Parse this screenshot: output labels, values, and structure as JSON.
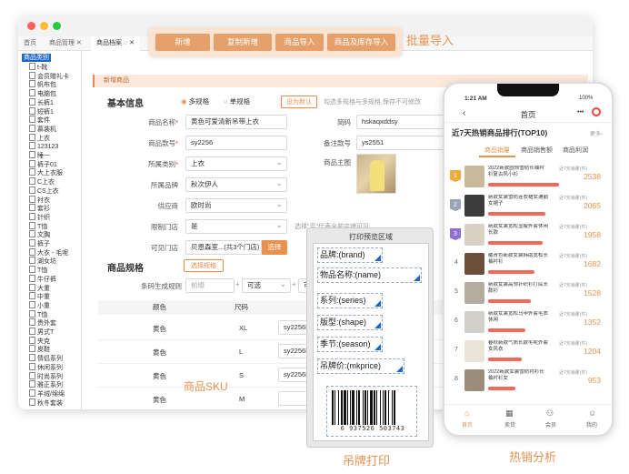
{
  "window": {
    "tabs": [
      "首页",
      "商品管理",
      "商品档案"
    ],
    "sidebar_root": "商品类别",
    "sidebar_items": [
      "t-靴",
      "会员赠礼卡",
      "帆布包",
      "电脑包",
      "长裤1",
      "短裤1",
      "套件",
      "慕装机",
      "上衣",
      "123123",
      "睡一",
      "裤子01",
      "大上衣服",
      "C上衣",
      "CS上衣",
      "衬衣",
      "套衫",
      "针织",
      "T恤",
      "文胸",
      "裤子",
      "大衣 - 毛呢",
      "湖女坊",
      "T恤",
      "牛仔裤",
      "大重",
      "中重",
      "小重",
      "T恤",
      "贵外套",
      "男式T",
      "夹克",
      "皮鞋",
      "情侣系列",
      "休闲系列",
      "时尚系列",
      "雅正系列",
      "羊绒/绵绵",
      "秋冬套装"
    ],
    "section_title": "新增商品",
    "basic_info_heading": "基本信息",
    "spec_mode": {
      "multi": "多规格",
      "single": "单规格",
      "switch_button": "设为默认",
      "hint": "勾选多规格与多规格,保存不可修改"
    },
    "fields": {
      "name": {
        "label": "商品名称",
        "value": "黄色可爱清新吊带上衣"
      },
      "code": {
        "label": "商品款号",
        "value": "sy2256"
      },
      "category": {
        "label": "所属类别",
        "value": "上衣"
      },
      "brand": {
        "label": "所属品牌",
        "value": "秋次伊人"
      },
      "supplier": {
        "label": "供应商",
        "value": "欧时尚"
      },
      "limit_store": {
        "label": "限制门店",
        "value": "是"
      },
      "visible_store": {
        "label": "可见门店",
        "value": "贝恩森室...(共3个门店)",
        "button": "选择"
      },
      "short_code": {
        "label": "简码",
        "value": "hskaqxddsy"
      },
      "note_code": {
        "label": "备注款号",
        "value": "ys2551"
      },
      "main_image": {
        "label": "商品主图"
      }
    },
    "limit_hint": "选择\"否\"代表全部店铺可见",
    "spec_heading": "商品规格",
    "spec_select_button": "选择规格",
    "barcode_rule_label": "条码生成规则",
    "barcode_rule_inputs": [
      "前缀",
      "可选",
      "可选"
    ],
    "table_headers": [
      "颜色",
      "尺码"
    ],
    "table_rows": [
      {
        "color": "黄色",
        "size": "XL",
        "code": "sy2256HS21"
      },
      {
        "color": "黄色",
        "size": "L",
        "code": "sy2256HS21"
      },
      {
        "color": "黄色",
        "size": "S",
        "code": "sy2256HS1"
      },
      {
        "color": "黄色",
        "size": "M",
        "code": ""
      }
    ]
  },
  "toolbar": {
    "buttons": [
      "新增",
      "复制新增",
      "商品导入",
      "商品及库存导入"
    ],
    "caption": "批量导入"
  },
  "print": {
    "title": "打印预览区域",
    "fields": [
      "品牌:(brand)",
      "物品名称:(name)",
      "系列:(series)",
      "版型:(shape)",
      "季节:(season)",
      "吊牌价:(mkprice)"
    ],
    "barcode_number": "6 937526 503743",
    "caption": "吊牌打印"
  },
  "sku_caption": "商品SKU",
  "phone": {
    "time": "1:21 AM",
    "battery": "100%",
    "nav_title": "首页",
    "page_title": "近7天热销商品排行(TOP10)",
    "more": "更多",
    "tabs": [
      "商品销量",
      "商品销售额",
      "商品利润"
    ],
    "unit": "近7天销量(件)",
    "items": [
      {
        "rank": "1",
        "name": "2022新款圆领雪纺长袖衬衫复古风小衫",
        "value": "2538",
        "fill": 1.0
      },
      {
        "rank": "2",
        "name": "新款女装雪纺连衣裙女通勤女裙子",
        "value": "2065",
        "fill": 0.81
      },
      {
        "rank": "3",
        "name": "新款女装宽松显瘦外套休闲长款",
        "value": "1958",
        "fill": 0.77
      },
      {
        "rank": "4",
        "name": "藏青色新款女装韩版宽松长袖衬衫",
        "value": "1682",
        "fill": 0.66
      },
      {
        "rank": "5",
        "name": "新款女装高领针织衫打底长款衫",
        "value": "1528",
        "fill": 0.6
      },
      {
        "rank": "6",
        "name": "新款女装宽松马甲外套毛衣休闲",
        "value": "1352",
        "fill": 0.53
      },
      {
        "rank": "7",
        "name": "春秋新款气质长款毛呢外套女风衣",
        "value": "1204",
        "fill": 0.47
      },
      {
        "rank": "8",
        "name": "2022新款女装雪纺衬衫长袖衬衫女",
        "value": "953",
        "fill": 0.38
      }
    ],
    "bottom_nav": [
      "首页",
      "卖货",
      "会员",
      "我的"
    ],
    "caption": "热销分析"
  },
  "colors": {
    "accent": "#e8914f",
    "bar": "#f26a5a",
    "rank_gold": "#f0a93b",
    "rank_silver": "#9aa4b6",
    "rank_bronze": "#8c6ed6"
  }
}
